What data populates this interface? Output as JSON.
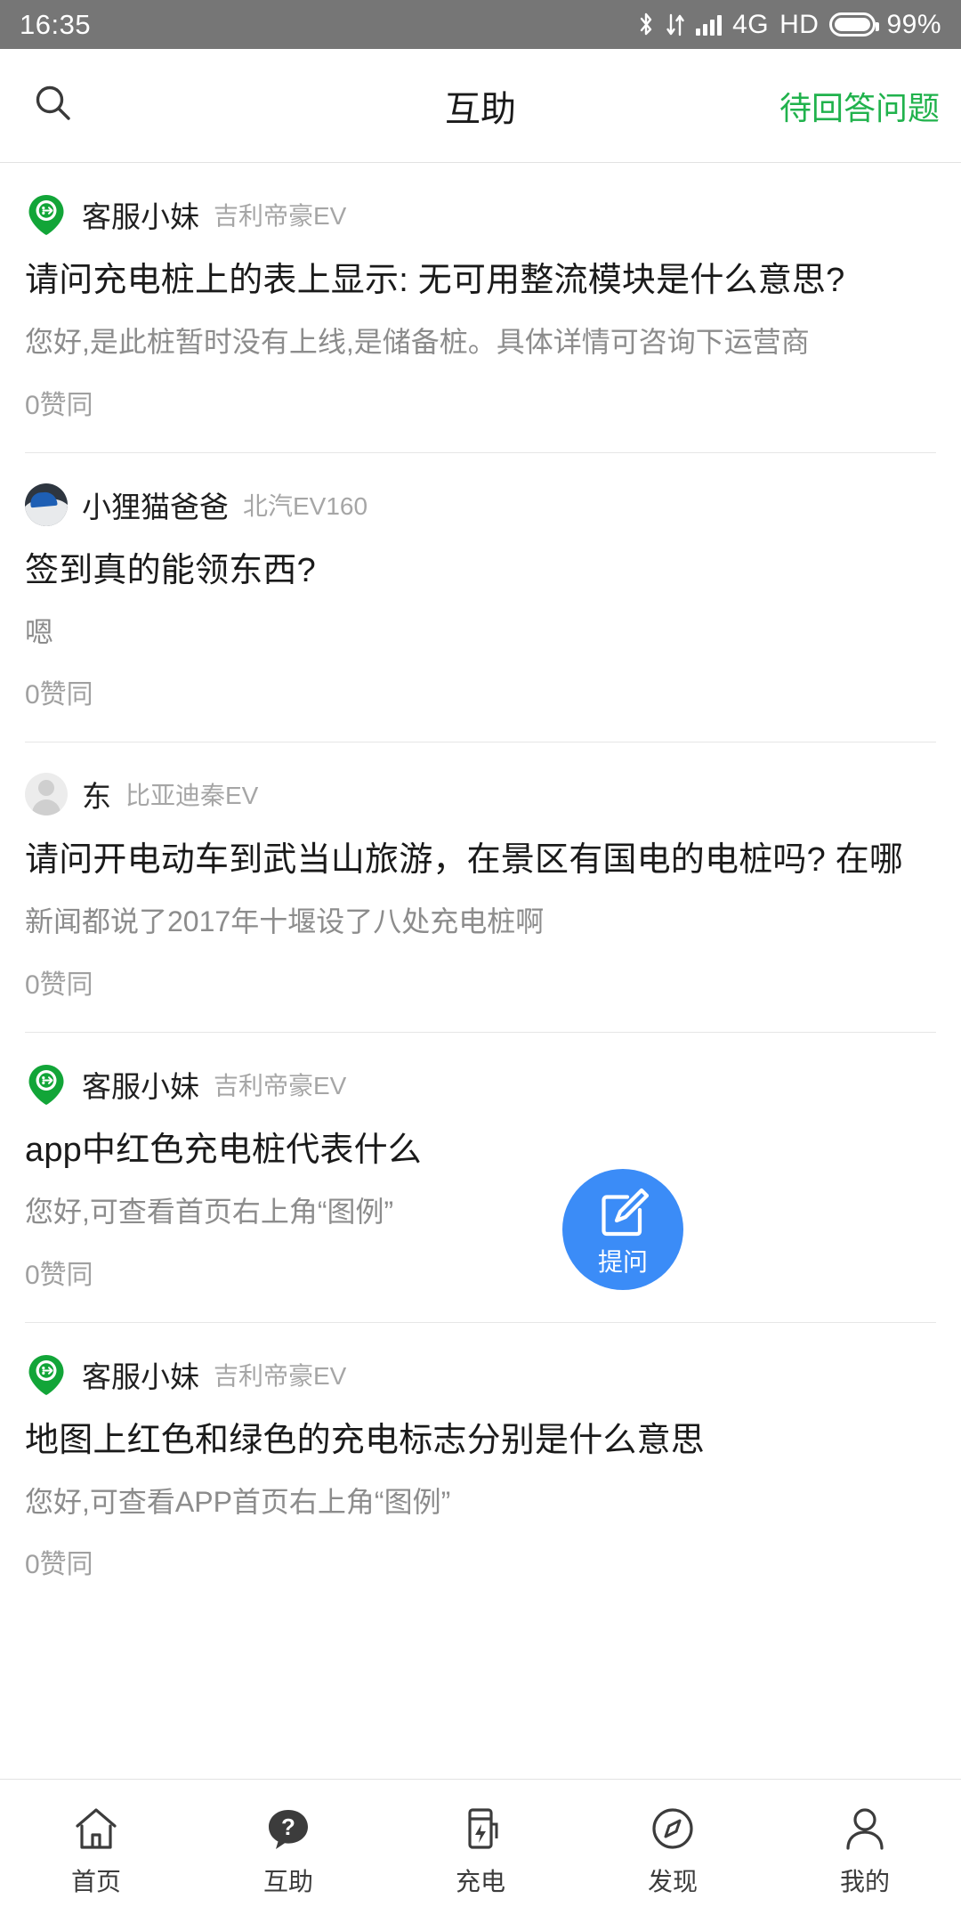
{
  "statusbar": {
    "time": "16:35",
    "network": "4G",
    "hd": "HD",
    "battery_pct": "99%",
    "icons": [
      "bluetooth-icon",
      "data-transfer-icon",
      "signal-bars-icon",
      "battery-icon"
    ]
  },
  "header": {
    "search_icon": "search-icon",
    "title": "互助",
    "action_label": "待回答问题",
    "action_color": "#20b24c"
  },
  "posts": [
    {
      "avatar_type": "green-pin",
      "author": "客服小妹",
      "car": "吉利帝豪EV",
      "title": "请问充电桩上的表上显示: 无可用整流模块是什么意思?",
      "answer": "您好,是此桩暂时没有上线,是储备桩。具体详情可咨询下运营商",
      "votes": "0赞同"
    },
    {
      "avatar_type": "photo",
      "author": "小狸猫爸爸",
      "car": "北汽EV160",
      "title": "签到真的能领东西?",
      "answer": "嗯",
      "votes": "0赞同"
    },
    {
      "avatar_type": "default",
      "author": "东",
      "car": "比亚迪秦EV",
      "title": "请问开电动车到武当山旅游，在景区有国电的电桩吗? 在哪",
      "answer": "新闻都说了2017年十堰设了八处充电桩啊",
      "votes": "0赞同"
    },
    {
      "avatar_type": "green-pin",
      "author": "客服小妹",
      "car": "吉利帝豪EV",
      "title": "app中红色充电桩代表什么",
      "answer": "您好,可查看首页右上角“图例”",
      "votes": "0赞同"
    },
    {
      "avatar_type": "green-pin",
      "author": "客服小妹",
      "car": "吉利帝豪EV",
      "title": "地图上红色和绿色的充电标志分别是什么意思",
      "answer": "您好,可查看APP首页右上角“图例”",
      "votes": "0赞同"
    }
  ],
  "fab": {
    "icon": "edit-pencil-icon",
    "label": "提问",
    "color": "#3b8cf7"
  },
  "tabbar": {
    "active_index": 1,
    "items": [
      {
        "icon": "home-icon",
        "label": "首页"
      },
      {
        "icon": "question-bubble-icon",
        "label": "互助"
      },
      {
        "icon": "charging-pile-icon",
        "label": "充电"
      },
      {
        "icon": "compass-icon",
        "label": "发现"
      },
      {
        "icon": "person-icon",
        "label": "我的"
      }
    ]
  }
}
